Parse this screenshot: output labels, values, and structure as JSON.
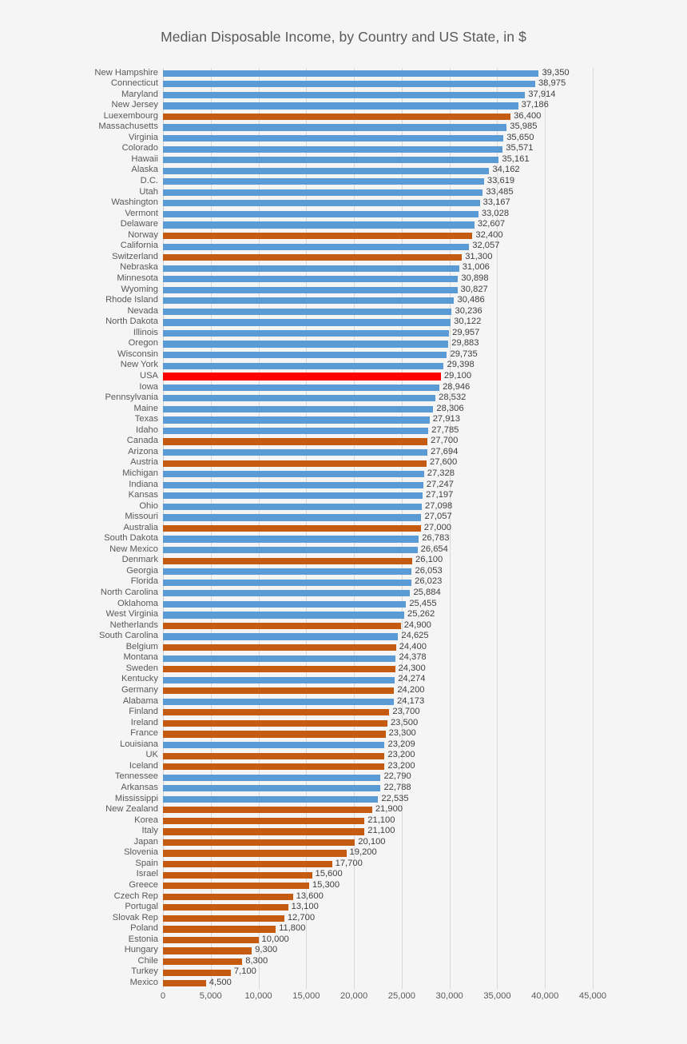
{
  "chart_data": {
    "type": "bar",
    "orientation": "horizontal",
    "title": "Median Disposable Income, by Country and US State, in $",
    "xlabel": "",
    "ylabel": "",
    "xlim": [
      0,
      45000
    ],
    "xticks": [
      "0",
      "5,000",
      "10,000",
      "15,000",
      "20,000",
      "25,000",
      "30,000",
      "35,000",
      "40,000",
      "45,000"
    ],
    "xtick_values": [
      0,
      5000,
      10000,
      15000,
      20000,
      25000,
      30000,
      35000,
      40000,
      45000
    ],
    "grid": "vertical",
    "legend": "none",
    "colors": {
      "us_state": "#5B9BD5",
      "country": "#C55A11",
      "usa_highlight": "#FF0000",
      "background": "#F5F5F5",
      "gridline": "#D9D9D9",
      "text": "#595959"
    },
    "categories": [
      "New Hampshire",
      "Connecticut",
      "Maryland",
      "New Jersey",
      "Luexembourg",
      "Massachusetts",
      "Virginia",
      "Colorado",
      "Hawaii",
      "Alaska",
      "D.C.",
      "Utah",
      "Washington",
      "Vermont",
      "Delaware",
      "Norway",
      "California",
      "Switzerland",
      "Nebraska",
      "Minnesota",
      "Wyoming",
      "Rhode Island",
      "Nevada",
      "North Dakota",
      "Illinois",
      "Oregon",
      "Wisconsin",
      "New York",
      "USA",
      "Iowa",
      "Pennsylvania",
      "Maine",
      "Texas",
      "Idaho",
      "Canada",
      "Arizona",
      "Austria",
      "Michigan",
      "Indiana",
      "Kansas",
      "Ohio",
      "Missouri",
      "Australia",
      "South Dakota",
      "New Mexico",
      "Denmark",
      "Georgia",
      "Florida",
      "North Carolina",
      "Oklahoma",
      "West Virginia",
      "Netherlands",
      "South Carolina",
      "Belgium",
      "Montana",
      "Sweden",
      "Kentucky",
      "Germany",
      "Alabama",
      "Finland",
      "Ireland",
      "France",
      "Louisiana",
      "UK",
      "Iceland",
      "Tennessee",
      "Arkansas",
      "Mississippi",
      "New Zealand",
      "Korea",
      "Italy",
      "Japan",
      "Slovenia",
      "Spain",
      "Israel",
      "Greece",
      "Czech Rep",
      "Portugal",
      "Slovak Rep",
      "Poland",
      "Estonia",
      "Hungary",
      "Chile",
      "Turkey",
      "Mexico"
    ],
    "values": [
      39350,
      38975,
      37914,
      37186,
      36400,
      35985,
      35650,
      35571,
      35161,
      34162,
      33619,
      33485,
      33167,
      33028,
      32607,
      32400,
      32057,
      31300,
      31006,
      30898,
      30827,
      30486,
      30236,
      30122,
      29957,
      29883,
      29735,
      29398,
      29100,
      28946,
      28532,
      28306,
      27913,
      27785,
      27700,
      27694,
      27600,
      27328,
      27247,
      27197,
      27098,
      27057,
      27000,
      26783,
      26654,
      26100,
      26053,
      26023,
      25884,
      25455,
      25262,
      24900,
      24625,
      24400,
      24378,
      24300,
      24274,
      24200,
      24173,
      23700,
      23500,
      23300,
      23209,
      23200,
      23200,
      22790,
      22788,
      22535,
      21900,
      21100,
      21100,
      20100,
      19200,
      17700,
      15600,
      15300,
      13600,
      13100,
      12700,
      11800,
      10000,
      9300,
      8300,
      7100,
      4500
    ],
    "value_labels": [
      "39,350",
      "38,975",
      "37,914",
      "37,186",
      "36,400",
      "35,985",
      "35,650",
      "35,571",
      "35,161",
      "34,162",
      "33,619",
      "33,485",
      "33,167",
      "33,028",
      "32,607",
      "32,400",
      "32,057",
      "31,300",
      "31,006",
      "30,898",
      "30,827",
      "30,486",
      "30,236",
      "30,122",
      "29,957",
      "29,883",
      "29,735",
      "29,398",
      "29,100",
      "28,946",
      "28,532",
      "28,306",
      "27,913",
      "27,785",
      "27,700",
      "27,694",
      "27,600",
      "27,328",
      "27,247",
      "27,197",
      "27,098",
      "27,057",
      "27,000",
      "26,783",
      "26,654",
      "26,100",
      "26,053",
      "26,023",
      "25,884",
      "25,455",
      "25,262",
      "24,900",
      "24,625",
      "24,400",
      "24,378",
      "24,300",
      "24,274",
      "24,200",
      "24,173",
      "23,700",
      "23,500",
      "23,300",
      "23,209",
      "23,200",
      "23,200",
      "22,790",
      "22,788",
      "22,535",
      "21,900",
      "21,100",
      "21,100",
      "20,100",
      "19,200",
      "17,700",
      "15,600",
      "15,300",
      "13,600",
      "13,100",
      "12,700",
      "11,800",
      "10,000",
      "9,300",
      "8,300",
      "7,100",
      "4,500"
    ],
    "series_kind": [
      "us_state",
      "us_state",
      "us_state",
      "us_state",
      "country",
      "us_state",
      "us_state",
      "us_state",
      "us_state",
      "us_state",
      "us_state",
      "us_state",
      "us_state",
      "us_state",
      "us_state",
      "country",
      "us_state",
      "country",
      "us_state",
      "us_state",
      "us_state",
      "us_state",
      "us_state",
      "us_state",
      "us_state",
      "us_state",
      "us_state",
      "us_state",
      "usa_highlight",
      "us_state",
      "us_state",
      "us_state",
      "us_state",
      "us_state",
      "country",
      "us_state",
      "country",
      "us_state",
      "us_state",
      "us_state",
      "us_state",
      "us_state",
      "country",
      "us_state",
      "us_state",
      "country",
      "us_state",
      "us_state",
      "us_state",
      "us_state",
      "us_state",
      "country",
      "us_state",
      "country",
      "us_state",
      "country",
      "us_state",
      "country",
      "us_state",
      "country",
      "country",
      "country",
      "us_state",
      "country",
      "country",
      "us_state",
      "us_state",
      "us_state",
      "country",
      "country",
      "country",
      "country",
      "country",
      "country",
      "country",
      "country",
      "country",
      "country",
      "country",
      "country",
      "country",
      "country",
      "country",
      "country",
      "country"
    ]
  }
}
